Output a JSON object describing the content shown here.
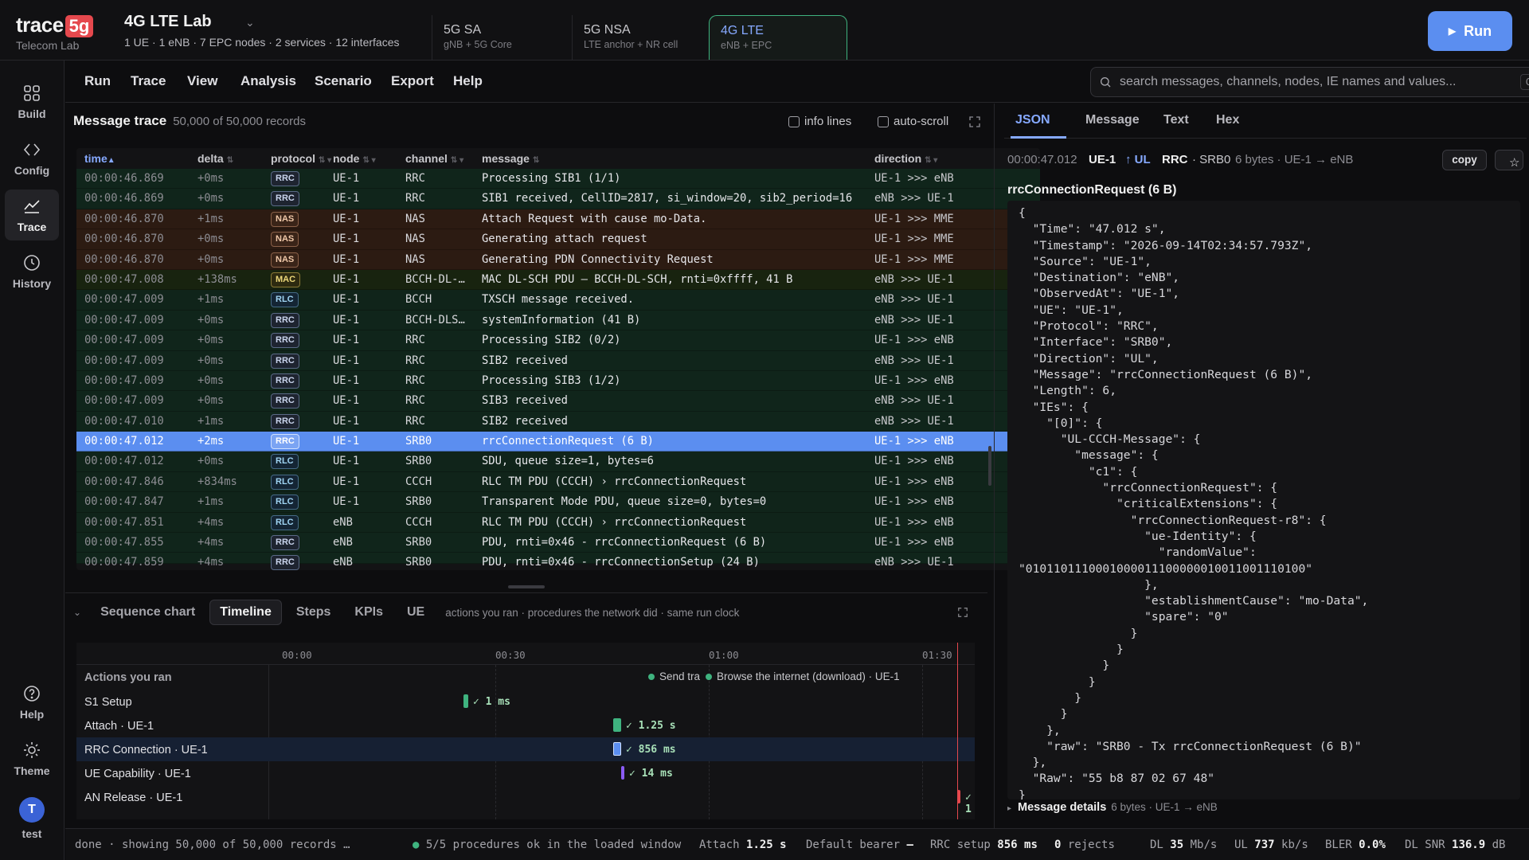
{
  "brand": {
    "name": "trace",
    "badge": "5g",
    "subtitle": "Telecom Lab"
  },
  "lab": {
    "title": "4G LTE Lab",
    "stats": "1 UE · 1 eNB · 7 EPC nodes · 2 services · 12 interfaces"
  },
  "modes": [
    {
      "name": "5G SA",
      "desc": "gNB + 5G Core"
    },
    {
      "name": "5G NSA",
      "desc": "LTE anchor + NR cell"
    },
    {
      "name": "4G LTE",
      "desc": "eNB + EPC"
    }
  ],
  "run_label": "Run",
  "rail": [
    {
      "label": "Build",
      "icon": "grid-icon"
    },
    {
      "label": "Config",
      "icon": "code-icon"
    },
    {
      "label": "Trace",
      "icon": "chart-line-icon"
    },
    {
      "label": "History",
      "icon": "clock-icon"
    },
    {
      "label": "Help",
      "icon": "help-icon"
    },
    {
      "label": "Theme",
      "icon": "sun-icon"
    }
  ],
  "user": {
    "initial": "T",
    "name": "test"
  },
  "menu": [
    "Run",
    "Trace",
    "View",
    "Analysis",
    "Scenario",
    "Export",
    "Help"
  ],
  "search": {
    "placeholder": "search messages, channels, nodes, IE names and values...",
    "shortcut": "Ctrl+F"
  },
  "trace": {
    "title": "Message trace",
    "count": "50,000 of 50,000 records",
    "info_lines": "info lines",
    "auto_scroll": "auto-scroll",
    "columns": [
      "time",
      "delta",
      "protocol",
      "node",
      "channel",
      "message",
      "direction"
    ],
    "rows": [
      {
        "time": "00:00:46.869",
        "delta": "+0ms",
        "proto": "RRC",
        "node": "UE-1",
        "chan": "RRC",
        "msg": "Processing SIB1 (1/1)",
        "dir": "UE-1 >>> eNB"
      },
      {
        "time": "00:00:46.869",
        "delta": "+0ms",
        "proto": "RRC",
        "node": "UE-1",
        "chan": "RRC",
        "msg": "SIB1 received, CellID=2817, si_window=20, sib2_period=16",
        "dir": "eNB >>> UE-1"
      },
      {
        "time": "00:00:46.870",
        "delta": "+1ms",
        "proto": "NAS",
        "node": "UE-1",
        "chan": "NAS",
        "msg": "Attach Request with cause mo-Data.",
        "dir": "UE-1 >>> MME"
      },
      {
        "time": "00:00:46.870",
        "delta": "+0ms",
        "proto": "NAS",
        "node": "UE-1",
        "chan": "NAS",
        "msg": "Generating attach request",
        "dir": "UE-1 >>> MME"
      },
      {
        "time": "00:00:46.870",
        "delta": "+0ms",
        "proto": "NAS",
        "node": "UE-1",
        "chan": "NAS",
        "msg": "Generating PDN Connectivity Request",
        "dir": "UE-1 >>> MME"
      },
      {
        "time": "00:00:47.008",
        "delta": "+138ms",
        "proto": "MAC",
        "node": "UE-1",
        "chan": "BCCH-DL-…",
        "msg": "MAC DL-SCH PDU — BCCH-DL-SCH, rnti=0xffff, 41 B",
        "dir": "eNB >>> UE-1"
      },
      {
        "time": "00:00:47.009",
        "delta": "+1ms",
        "proto": "RLC",
        "node": "UE-1",
        "chan": "BCCH",
        "msg": "TXSCH message received.",
        "dir": "eNB >>> UE-1"
      },
      {
        "time": "00:00:47.009",
        "delta": "+0ms",
        "proto": "RRC",
        "node": "UE-1",
        "chan": "BCCH-DLS…",
        "msg": "systemInformation (41 B)",
        "dir": "eNB >>> UE-1"
      },
      {
        "time": "00:00:47.009",
        "delta": "+0ms",
        "proto": "RRC",
        "node": "UE-1",
        "chan": "RRC",
        "msg": "Processing SIB2 (0/2)",
        "dir": "UE-1 >>> eNB"
      },
      {
        "time": "00:00:47.009",
        "delta": "+0ms",
        "proto": "RRC",
        "node": "UE-1",
        "chan": "RRC",
        "msg": "SIB2 received",
        "dir": "eNB >>> UE-1"
      },
      {
        "time": "00:00:47.009",
        "delta": "+0ms",
        "proto": "RRC",
        "node": "UE-1",
        "chan": "RRC",
        "msg": "Processing SIB3 (1/2)",
        "dir": "UE-1 >>> eNB"
      },
      {
        "time": "00:00:47.009",
        "delta": "+0ms",
        "proto": "RRC",
        "node": "UE-1",
        "chan": "RRC",
        "msg": "SIB3 received",
        "dir": "eNB >>> UE-1"
      },
      {
        "time": "00:00:47.010",
        "delta": "+1ms",
        "proto": "RRC",
        "node": "UE-1",
        "chan": "RRC",
        "msg": "SIB2 received",
        "dir": "eNB >>> UE-1"
      },
      {
        "time": "00:00:47.012",
        "delta": "+2ms",
        "proto": "RRC",
        "node": "UE-1",
        "chan": "SRB0",
        "msg": "rrcConnectionRequest (6 B)",
        "dir": "UE-1 >>> eNB",
        "selected": true
      },
      {
        "time": "00:00:47.012",
        "delta": "+0ms",
        "proto": "RLC",
        "node": "UE-1",
        "chan": "SRB0",
        "msg": "SDU, queue size=1, bytes=6",
        "dir": "UE-1 >>> eNB"
      },
      {
        "time": "00:00:47.846",
        "delta": "+834ms",
        "proto": "RLC",
        "node": "UE-1",
        "chan": "CCCH",
        "msg": "RLC TM PDU (CCCH) › rrcConnectionRequest",
        "dir": "UE-1 >>> eNB"
      },
      {
        "time": "00:00:47.847",
        "delta": "+1ms",
        "proto": "RLC",
        "node": "UE-1",
        "chan": "SRB0",
        "msg": "Transparent Mode PDU, queue size=0, bytes=0",
        "dir": "UE-1 >>> eNB"
      },
      {
        "time": "00:00:47.851",
        "delta": "+4ms",
        "proto": "RLC",
        "node": "eNB",
        "chan": "CCCH",
        "msg": "RLC TM PDU (CCCH) › rrcConnectionRequest",
        "dir": "UE-1 >>> eNB"
      },
      {
        "time": "00:00:47.855",
        "delta": "+4ms",
        "proto": "RRC",
        "node": "eNB",
        "chan": "SRB0",
        "msg": "PDU, rnti=0x46 - rrcConnectionRequest (6 B)",
        "dir": "UE-1 >>> eNB"
      },
      {
        "time": "00:00:47.859",
        "delta": "+4ms",
        "proto": "RRC",
        "node": "eNB",
        "chan": "SRB0",
        "msg": "PDU, rnti=0x46 - rrcConnectionSetup (24 B)",
        "dir": "eNB >>> UE-1",
        "partial": true
      }
    ]
  },
  "bottom": {
    "tabs": [
      "Sequence chart",
      "Timeline",
      "Steps",
      "KPIs",
      "UE"
    ],
    "active_tab": "Timeline",
    "hint": "actions you ran · procedures the network did · same run clock",
    "ticks": [
      "00:00",
      "00:30",
      "01:00",
      "01:30"
    ],
    "header_label": "Actions you ran",
    "events": [
      {
        "label": "Send tra"
      },
      {
        "label": "Browse the internet (download) · UE-1"
      }
    ],
    "procedures": [
      {
        "name": "S1 Setup",
        "dur": "1 ms",
        "color": "#3fb37f"
      },
      {
        "name": "Attach · UE-1",
        "dur": "1.25 s",
        "color": "#3fb37f"
      },
      {
        "name": "RRC Connection · UE-1",
        "dur": "856 ms",
        "color": "#5b8ef0"
      },
      {
        "name": "UE Capability · UE-1",
        "dur": "14 ms",
        "color": "#8b5cf6"
      },
      {
        "name": "AN Release · UE-1",
        "dur": "1",
        "color": "#e5484d"
      }
    ]
  },
  "status": {
    "done": "done · showing 50,000 of 50,000 records …",
    "procs": "5/5 procedures ok in the loaded window",
    "attach_label": "Attach",
    "attach_val": "1.25 s",
    "bearer_label": "Default bearer",
    "bearer_val": "—",
    "rrc_label": "RRC setup",
    "rrc_val": "856 ms",
    "rejects_val": "0",
    "rejects_label": "rejects",
    "dl_label": "DL",
    "dl_val": "35",
    "dl_unit": "Mb/s",
    "ul_label": "UL",
    "ul_val": "737",
    "ul_unit": "kb/s",
    "bler_label": "BLER",
    "bler_val": "0.0%",
    "snr_label": "DL SNR",
    "snr_val": "136.9",
    "snr_unit": "dB"
  },
  "detail": {
    "tabs": [
      "JSON",
      "Message",
      "Text",
      "Hex"
    ],
    "active_tab": "JSON",
    "time": "00:00:47.012",
    "ue": "UE-1",
    "direction": "↑ UL",
    "proto": "RRC",
    "iface": "· SRB0",
    "info": "6 bytes · UE-1 → eNB",
    "copy_label": "copy",
    "title": "rrcConnectionRequest (6 B)",
    "json": "{\n  \"Time\": \"47.012 s\",\n  \"Timestamp\": \"2026-09-14T02:34:57.793Z\",\n  \"Source\": \"UE-1\",\n  \"Destination\": \"eNB\",\n  \"ObservedAt\": \"UE-1\",\n  \"UE\": \"UE-1\",\n  \"Protocol\": \"RRC\",\n  \"Interface\": \"SRB0\",\n  \"Direction\": \"UL\",\n  \"Message\": \"rrcConnectionRequest (6 B)\",\n  \"Length\": 6,\n  \"IEs\": {\n    \"[0]\": {\n      \"UL-CCCH-Message\": {\n        \"message\": {\n          \"c1\": {\n            \"rrcConnectionRequest\": {\n              \"criticalExtensions\": {\n                \"rrcConnectionRequest-r8\": {\n                  \"ue-Identity\": {\n                    \"randomValue\":\n\"0101101110001000011100000010011001110100\"\n                  },\n                  \"establishmentCause\": \"mo-Data\",\n                  \"spare\": \"0\"\n                }\n              }\n            }\n          }\n        }\n      }\n    },\n    \"raw\": \"SRB0 - Tx rrcConnectionRequest (6 B)\"\n  },\n  \"Raw\": \"55 b8 87 02 67 48\"\n}",
    "details_label": "Message details",
    "details_info": "6 bytes · UE-1 → eNB"
  }
}
